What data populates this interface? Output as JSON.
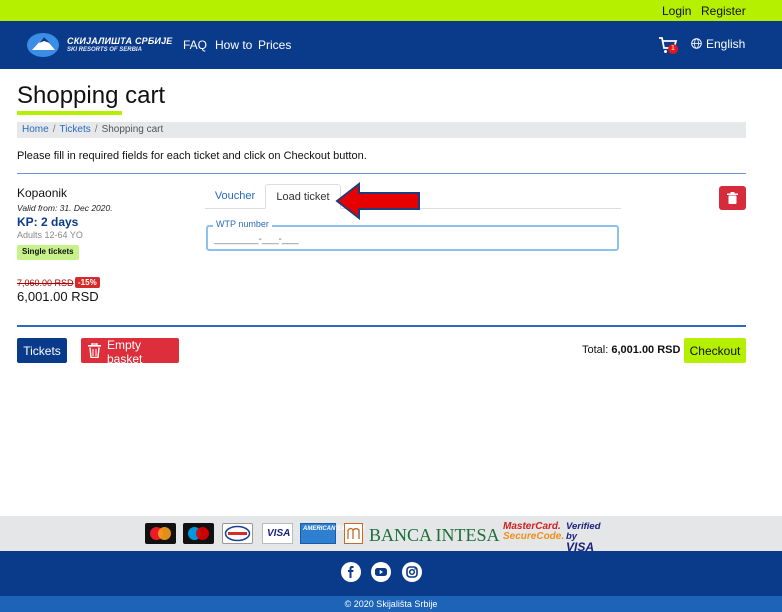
{
  "top_links": {
    "login": "Login",
    "register": "Register"
  },
  "brand": {
    "title": "СКИЈАЛИШТА СРБИЈЕ",
    "subtitle": "SKI RESORTS OF SERBIA"
  },
  "nav": {
    "faq": "FAQ",
    "how_to": "How to",
    "prices": "Prices"
  },
  "cart": {
    "count": "1"
  },
  "language": "English",
  "page": {
    "title": "Shopping cart",
    "breadcrumb": [
      "Home",
      "Tickets",
      "Shopping cart"
    ],
    "instructions": "Please fill in required fields for each ticket and click on Checkout button."
  },
  "item": {
    "place": "Kopaonik",
    "valid_from": "Valid from: 31. Dec 2020.",
    "product": "KP: 2 days",
    "age_group": "Adults 12-64 YO",
    "ticket_type": "Single tickets",
    "old_price": "7,060.00 RSD",
    "discount": "-15%",
    "price": "6,001.00 RSD"
  },
  "tabs": {
    "voucher": "Voucher",
    "load_ticket": "Load ticket"
  },
  "wtp": {
    "label": "WTP number",
    "placeholder": "________-___-___"
  },
  "actions": {
    "tickets": "Tickets",
    "empty_basket": "Empty basket",
    "checkout": "Checkout"
  },
  "total": {
    "label": "Total:",
    "value": "6,001.00 RSD"
  },
  "payments": {
    "visa": "VISA",
    "amex": "AMERICAN EXPRESS",
    "intesa": "BANCA INTESA",
    "mastercard_securecode": [
      "MasterCard.",
      "SecureCode."
    ],
    "verified_by_visa": [
      "Verified by",
      "VISA"
    ]
  },
  "footer": {
    "copyright": "© 2020 Skijališta Srbije"
  },
  "colors": {
    "lime": "#b4f000",
    "navy": "#0a3a8a",
    "danger": "#d62b3b"
  },
  "icons": [
    "cart-icon",
    "globe-icon",
    "trash-icon",
    "facebook-icon",
    "youtube-icon",
    "instagram-icon"
  ]
}
